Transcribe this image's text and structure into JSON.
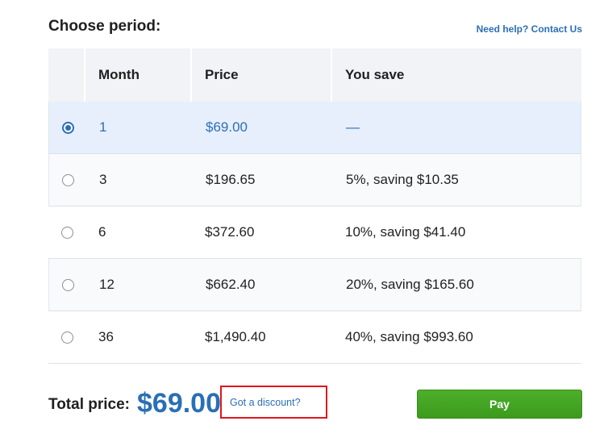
{
  "title": "Choose period:",
  "help_link": "Need help? Contact Us",
  "table": {
    "headers": [
      "Month",
      "Price",
      "You save"
    ],
    "rows": [
      {
        "month": "1",
        "price": "$69.00",
        "save": "—",
        "selected": true
      },
      {
        "month": "3",
        "price": "$196.65",
        "save": "5%, saving $10.35",
        "selected": false
      },
      {
        "month": "6",
        "price": "$372.60",
        "save": "10%, saving $41.40",
        "selected": false
      },
      {
        "month": "12",
        "price": "$662.40",
        "save": "20%, saving $165.60",
        "selected": false
      },
      {
        "month": "36",
        "price": "$1,490.40",
        "save": "40%, saving $993.60",
        "selected": false
      }
    ]
  },
  "total": {
    "label": "Total price:",
    "value": "$69.00"
  },
  "discount_link": "Got a discount?",
  "pay_button": "Pay",
  "colors": {
    "accent": "#2a6fb5",
    "pay_green": "#44a524",
    "highlight_box": "#e0161d",
    "selected_row": "#e7effc"
  }
}
